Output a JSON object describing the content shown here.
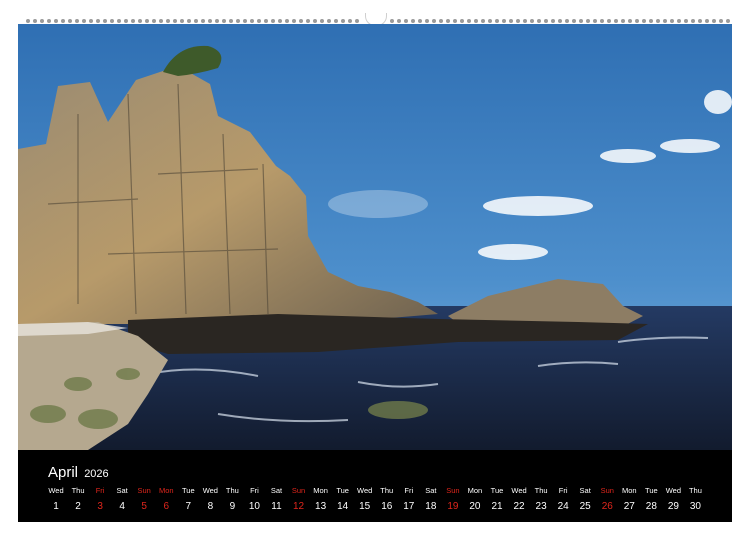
{
  "calendar": {
    "month": "April",
    "year": "2026",
    "days": [
      {
        "dn": "Wed",
        "dd": "1",
        "red": false
      },
      {
        "dn": "Thu",
        "dd": "2",
        "red": false
      },
      {
        "dn": "Fri",
        "dd": "3",
        "red": true
      },
      {
        "dn": "Sat",
        "dd": "4",
        "red": false
      },
      {
        "dn": "Sun",
        "dd": "5",
        "red": true
      },
      {
        "dn": "Mon",
        "dd": "6",
        "red": true
      },
      {
        "dn": "Tue",
        "dd": "7",
        "red": false
      },
      {
        "dn": "Wed",
        "dd": "8",
        "red": false
      },
      {
        "dn": "Thu",
        "dd": "9",
        "red": false
      },
      {
        "dn": "Fri",
        "dd": "10",
        "red": false
      },
      {
        "dn": "Sat",
        "dd": "11",
        "red": false
      },
      {
        "dn": "Sun",
        "dd": "12",
        "red": true
      },
      {
        "dn": "Mon",
        "dd": "13",
        "red": false
      },
      {
        "dn": "Tue",
        "dd": "14",
        "red": false
      },
      {
        "dn": "Wed",
        "dd": "15",
        "red": false
      },
      {
        "dn": "Thu",
        "dd": "16",
        "red": false
      },
      {
        "dn": "Fri",
        "dd": "17",
        "red": false
      },
      {
        "dn": "Sat",
        "dd": "18",
        "red": false
      },
      {
        "dn": "Sun",
        "dd": "19",
        "red": true
      },
      {
        "dn": "Mon",
        "dd": "20",
        "red": false
      },
      {
        "dn": "Tue",
        "dd": "21",
        "red": false
      },
      {
        "dn": "Wed",
        "dd": "22",
        "red": false
      },
      {
        "dn": "Thu",
        "dd": "23",
        "red": false
      },
      {
        "dn": "Fri",
        "dd": "24",
        "red": false
      },
      {
        "dn": "Sat",
        "dd": "25",
        "red": false
      },
      {
        "dn": "Sun",
        "dd": "26",
        "red": true
      },
      {
        "dn": "Mon",
        "dd": "27",
        "red": false
      },
      {
        "dn": "Tue",
        "dd": "28",
        "red": false
      },
      {
        "dn": "Wed",
        "dd": "29",
        "red": false
      },
      {
        "dn": "Thu",
        "dd": "30",
        "red": false
      }
    ]
  },
  "colors": {
    "holiday": "#e0261c",
    "sky_top": "#2f6fb3",
    "sea": "#1c2c4a",
    "rock": "#8a7a62"
  }
}
